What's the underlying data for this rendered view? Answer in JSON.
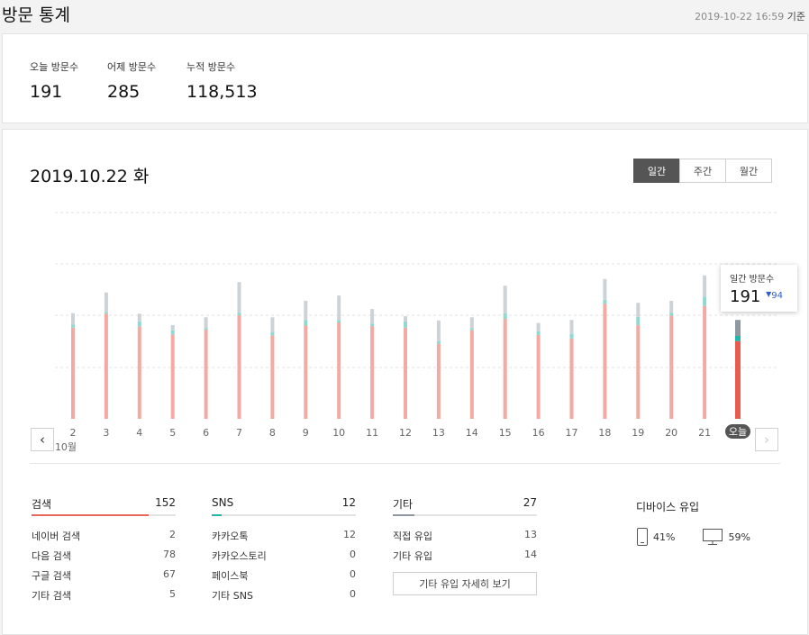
{
  "header": {
    "title": "방문 통계",
    "timestamp": "2019-10-22 16:59",
    "timestamp_suffix": "기준"
  },
  "summary": [
    {
      "label": "오늘 방문수",
      "value": "191"
    },
    {
      "label": "어제 방문수",
      "value": "285"
    },
    {
      "label": "누적 방문수",
      "value": "118,513"
    }
  ],
  "main": {
    "date_title": "2019.10.22 화",
    "period_tabs": [
      {
        "label": "일간",
        "active": true
      },
      {
        "label": "주간",
        "active": false
      },
      {
        "label": "월간",
        "active": false
      }
    ],
    "prev_icon": "chevron-left-icon",
    "next_icon": "chevron-right-icon"
  },
  "chart_data": {
    "type": "bar",
    "stacked": true,
    "month_label": "10월",
    "categories": [
      "2",
      "3",
      "4",
      "5",
      "6",
      "7",
      "8",
      "9",
      "10",
      "11",
      "12",
      "13",
      "14",
      "15",
      "16",
      "17",
      "18",
      "19",
      "20",
      "21",
      "오늘"
    ],
    "series": [
      {
        "color": "#f2aaa2",
        "today_color": "#e85c4f",
        "values": [
          176,
          203,
          178,
          163,
          172,
          200,
          161,
          180,
          186,
          179,
          176,
          145,
          171,
          193,
          162,
          155,
          222,
          181,
          199,
          218,
          150
        ]
      },
      {
        "color": "#8fd9d1",
        "today_color": "#1fb7a8",
        "values": [
          6,
          3,
          10,
          8,
          3,
          5,
          6,
          11,
          5,
          5,
          12,
          5,
          4,
          11,
          7,
          9,
          8,
          16,
          6,
          18,
          10
        ]
      },
      {
        "color": "#cdd2d6",
        "today_color": "#8f97a1",
        "values": [
          22,
          38,
          15,
          10,
          21,
          59,
          29,
          37,
          47,
          28,
          10,
          40,
          21,
          53,
          16,
          27,
          40,
          27,
          23,
          41,
          31
        ]
      }
    ],
    "grid": true,
    "tooltip": {
      "label": "일간 방문수",
      "value": "191",
      "delta": "94",
      "delta_icon": "triangle-down-icon"
    }
  },
  "breakdown": [
    {
      "title": "검색",
      "total": "152",
      "accent": "#e8665a",
      "fill": 0.81,
      "rows": [
        {
          "label": "네이버 검색",
          "value": "2"
        },
        {
          "label": "다음 검색",
          "value": "78"
        },
        {
          "label": "구글 검색",
          "value": "67"
        },
        {
          "label": "기타 검색",
          "value": "5"
        }
      ]
    },
    {
      "title": "SNS",
      "total": "12",
      "accent": "#1fb7a8",
      "fill": 0.07,
      "rows": [
        {
          "label": "카카오톡",
          "value": "12"
        },
        {
          "label": "카카오스토리",
          "value": "0"
        },
        {
          "label": "페이스북",
          "value": "0"
        },
        {
          "label": "기타 SNS",
          "value": "0"
        }
      ]
    },
    {
      "title": "기타",
      "total": "27",
      "accent": "#8f97a1",
      "fill": 0.15,
      "rows": [
        {
          "label": "직접 유입",
          "value": "13"
        },
        {
          "label": "기타 유입",
          "value": "14"
        }
      ],
      "button": "기타 유입 자세히 보기"
    }
  ],
  "device": {
    "title": "디바이스 유입",
    "mobile": {
      "icon": "mobile-icon",
      "value": "41%"
    },
    "pc": {
      "icon": "monitor-icon",
      "value": "59%"
    }
  }
}
